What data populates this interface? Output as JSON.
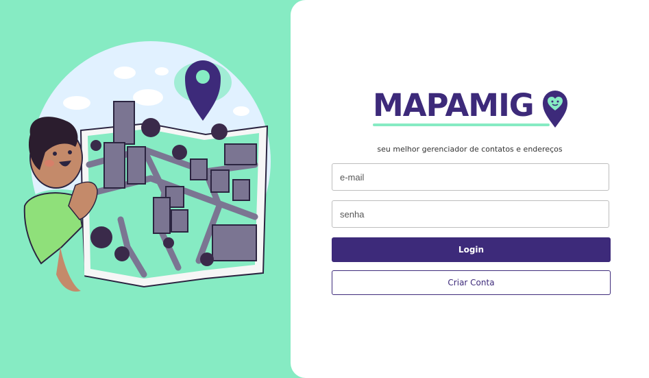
{
  "colors": {
    "brand_purple": "#3d2a7a",
    "mint": "#86ebc3",
    "background": "#ffffff"
  },
  "brand": {
    "name": "MAPAMIGO",
    "text": "MAPAMIG",
    "tagline": "seu melhor gerenciador de contatos e endereços"
  },
  "form": {
    "email_placeholder": "e-mail",
    "password_placeholder": "senha",
    "login_label": "Login",
    "signup_label": "Criar Conta"
  },
  "icons": {
    "illustration": "person-with-city-map-illustration",
    "logo_o": "heart-location-pin-icon",
    "pin": "location-pin-icon"
  }
}
